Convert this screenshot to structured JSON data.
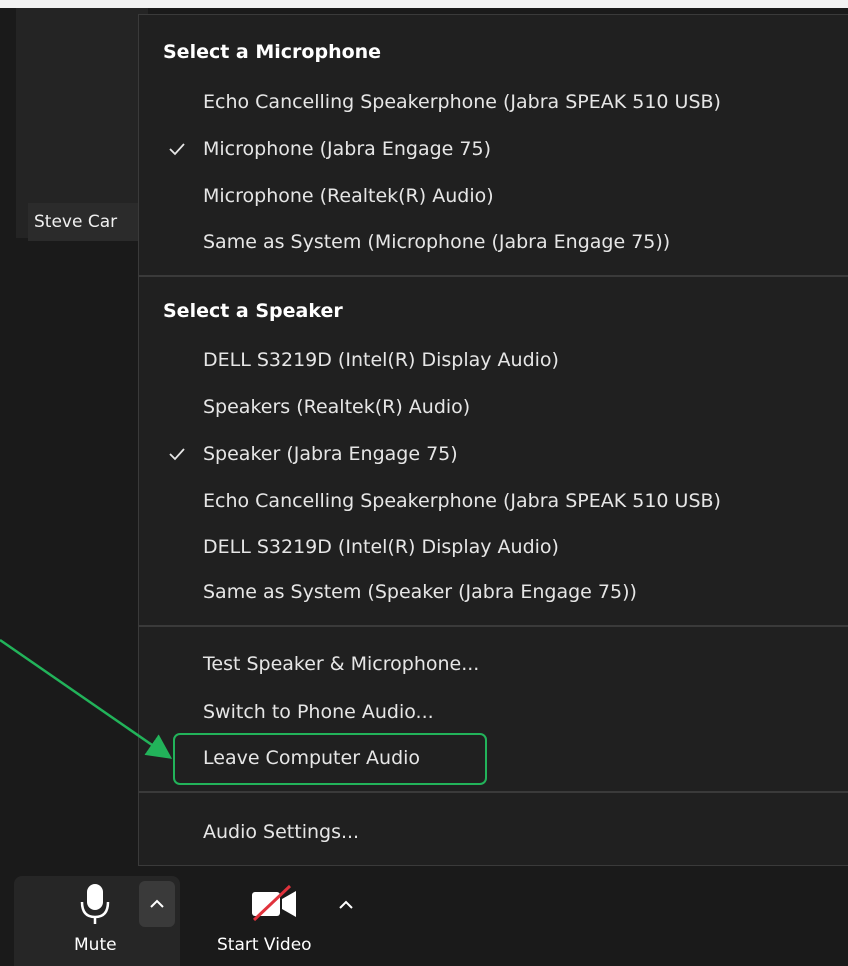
{
  "participant": {
    "name": "Steve Car"
  },
  "menu": {
    "microphone_header": "Select a Microphone",
    "microphones": [
      {
        "label": "Echo Cancelling Speakerphone (Jabra SPEAK 510 USB)",
        "checked": false
      },
      {
        "label": "Microphone (Jabra Engage 75)",
        "checked": true
      },
      {
        "label": "Microphone (Realtek(R) Audio)",
        "checked": false
      },
      {
        "label": "Same as System (Microphone (Jabra Engage 75))",
        "checked": false
      }
    ],
    "speaker_header": "Select a Speaker",
    "speakers": [
      {
        "label": "DELL S3219D (Intel(R) Display Audio)",
        "checked": false
      },
      {
        "label": "Speakers (Realtek(R) Audio)",
        "checked": false
      },
      {
        "label": "Speaker (Jabra Engage 75)",
        "checked": true
      },
      {
        "label": "Echo Cancelling Speakerphone (Jabra SPEAK 510 USB)",
        "checked": false
      },
      {
        "label": "DELL S3219D (Intel(R) Display Audio)",
        "checked": false
      },
      {
        "label": "Same as System (Speaker (Jabra Engage 75))",
        "checked": false
      }
    ],
    "actions": {
      "test": "Test Speaker & Microphone...",
      "switch_phone": "Switch to Phone Audio...",
      "leave_audio": "Leave Computer Audio",
      "settings": "Audio Settings..."
    }
  },
  "toolbar": {
    "mute_label": "Mute",
    "video_label": "Start Video"
  },
  "colors": {
    "highlight": "#22b35a",
    "video_off_slash": "#e0323c"
  }
}
